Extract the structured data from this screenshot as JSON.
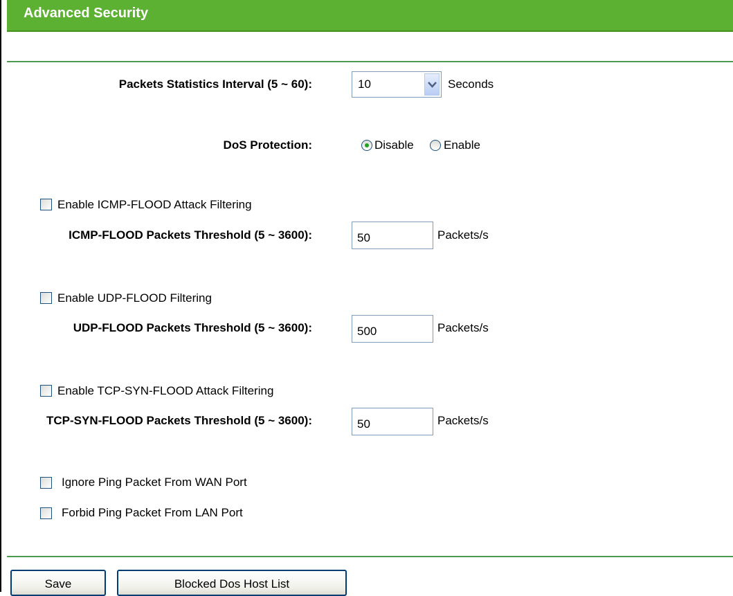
{
  "header": {
    "title": "Advanced Security"
  },
  "interval": {
    "label": "Packets Statistics Interval (5 ~ 60):",
    "value": "10",
    "unit": "Seconds"
  },
  "dos": {
    "label": "DoS Protection:",
    "options": [
      "Disable",
      "Enable"
    ],
    "selected": "Disable"
  },
  "icmp": {
    "checkbox_label": "Enable ICMP-FLOOD Attack Filtering",
    "checked": false,
    "threshold_label": "ICMP-FLOOD Packets Threshold (5 ~ 3600):",
    "value": "50",
    "unit": "Packets/s"
  },
  "udp": {
    "checkbox_label": "Enable UDP-FLOOD Filtering",
    "checked": false,
    "threshold_label": "UDP-FLOOD Packets Threshold (5 ~ 3600):",
    "value": "500",
    "unit": "Packets/s"
  },
  "tcp": {
    "checkbox_label": "Enable TCP-SYN-FLOOD Attack Filtering",
    "checked": false,
    "threshold_label": "TCP-SYN-FLOOD Packets Threshold (5 ~ 3600):",
    "value": "50",
    "unit": "Packets/s"
  },
  "ping": {
    "wan_label": "Ignore Ping Packet From WAN Port",
    "wan_checked": false,
    "lan_label": "Forbid Ping Packet From LAN Port",
    "lan_checked": false
  },
  "buttons": {
    "save": "Save",
    "blocked_list": "Blocked Dos Host List"
  },
  "colors": {
    "header_bg": "#5cb132",
    "divider": "#4e9a4e",
    "radio_selected": "#21a121"
  },
  "icons": {
    "dropdown": "chevron-down-icon"
  }
}
